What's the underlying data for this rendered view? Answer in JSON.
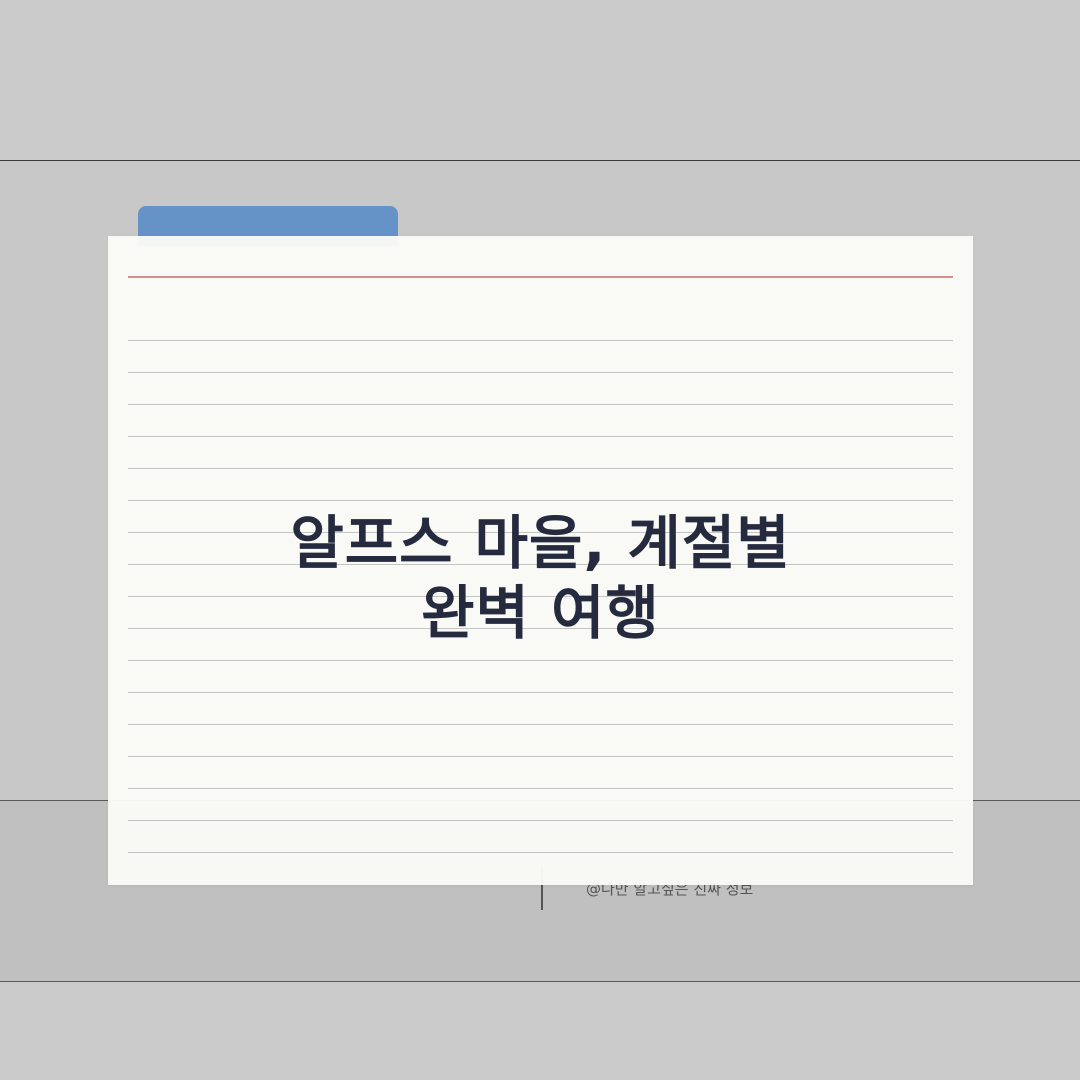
{
  "title": {
    "line1": "알프스 마을, 계절별",
    "line2": "완벽 여행"
  },
  "footer": {
    "credit": "@나만 알고싶은 진짜 정보"
  },
  "colors": {
    "background": "#cbcbcb",
    "folder_tab": "#6593c8",
    "card": "#fafaf6",
    "margin_line": "#d98f8f",
    "title_text": "#252a3e"
  }
}
